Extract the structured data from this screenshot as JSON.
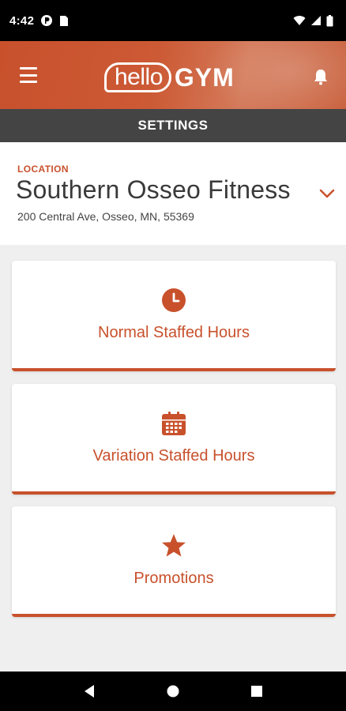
{
  "status_bar": {
    "time": "4:42"
  },
  "header": {
    "logo_hello": "hello",
    "logo_gym": "GYM",
    "brand_color": "#c8512c"
  },
  "page": {
    "title": "SETTINGS"
  },
  "location": {
    "label": "LOCATION",
    "name": "Southern Osseo Fitness",
    "address": "200 Central Ave, Osseo, MN, 55369"
  },
  "cards": [
    {
      "label": "Normal Staffed Hours",
      "icon": "clock-icon"
    },
    {
      "label": "Variation Staffed Hours",
      "icon": "calendar-icon"
    },
    {
      "label": "Promotions",
      "icon": "star-icon"
    }
  ]
}
